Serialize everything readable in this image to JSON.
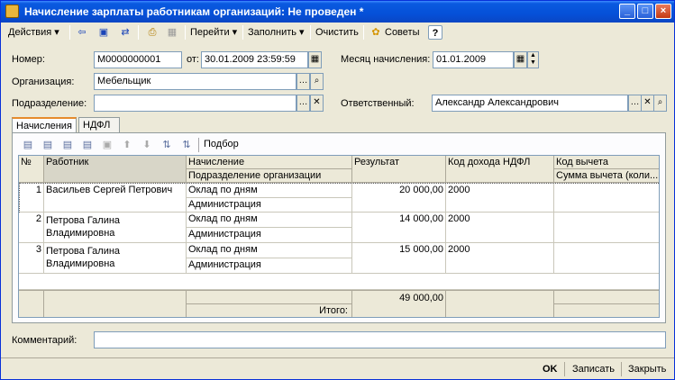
{
  "window": {
    "title": "Начисление зарплаты работникам организаций: Не проведен *"
  },
  "toolbar": {
    "actions": "Действия ▾",
    "goto": "Перейти ▾",
    "fill": "Заполнить ▾",
    "clear": "Очистить",
    "tips": "Советы",
    "help": "?"
  },
  "header": {
    "number_label": "Номер:",
    "number_value": "М0000000001",
    "date_label": "от:",
    "date_value": "30.01.2009 23:59:59",
    "month_label": "Месяц начисления:",
    "month_value": "01.01.2009",
    "org_label": "Организация:",
    "org_value": "Мебельщик",
    "dept_label": "Подразделение:",
    "dept_value": "",
    "resp_label": "Ответственный:",
    "resp_value": "Александр Александрович"
  },
  "tabs": [
    "Начисления",
    "НДФЛ"
  ],
  "grid_toolbar": {
    "select": "Подбор"
  },
  "grid": {
    "headers": {
      "num": "№",
      "worker": "Работник",
      "accrual": "Начисление",
      "dept": "Подразделение организации",
      "result": "Результат",
      "income_code": "Код дохода НДФЛ",
      "deduct_code": "Код вычета",
      "deduct_sum": "Сумма вычета (коли..."
    },
    "rows": [
      {
        "num": "1",
        "worker1": "Васильев Сергей Петрович",
        "worker2": "",
        "accrual": "Оклад по дням",
        "dept": "Администрация",
        "result": "20 000,00",
        "income_code": "2000"
      },
      {
        "num": "2",
        "worker1": "Петрова Галина",
        "worker2": "Владимировна",
        "accrual": "Оклад по дням",
        "dept": "Администрация",
        "result": "14 000,00",
        "income_code": "2000"
      },
      {
        "num": "3",
        "worker1": "Петрова Галина",
        "worker2": "Владимировна",
        "accrual": "Оклад по дням",
        "dept": "Администрация",
        "result": "15 000,00",
        "income_code": "2000"
      }
    ],
    "footer": {
      "total_label": "Итого:",
      "total_value": "49 000,00"
    }
  },
  "comment": {
    "label": "Комментарий:",
    "value": ""
  },
  "statusbar": {
    "ok": "OK",
    "save": "Записать",
    "close": "Закрыть"
  }
}
